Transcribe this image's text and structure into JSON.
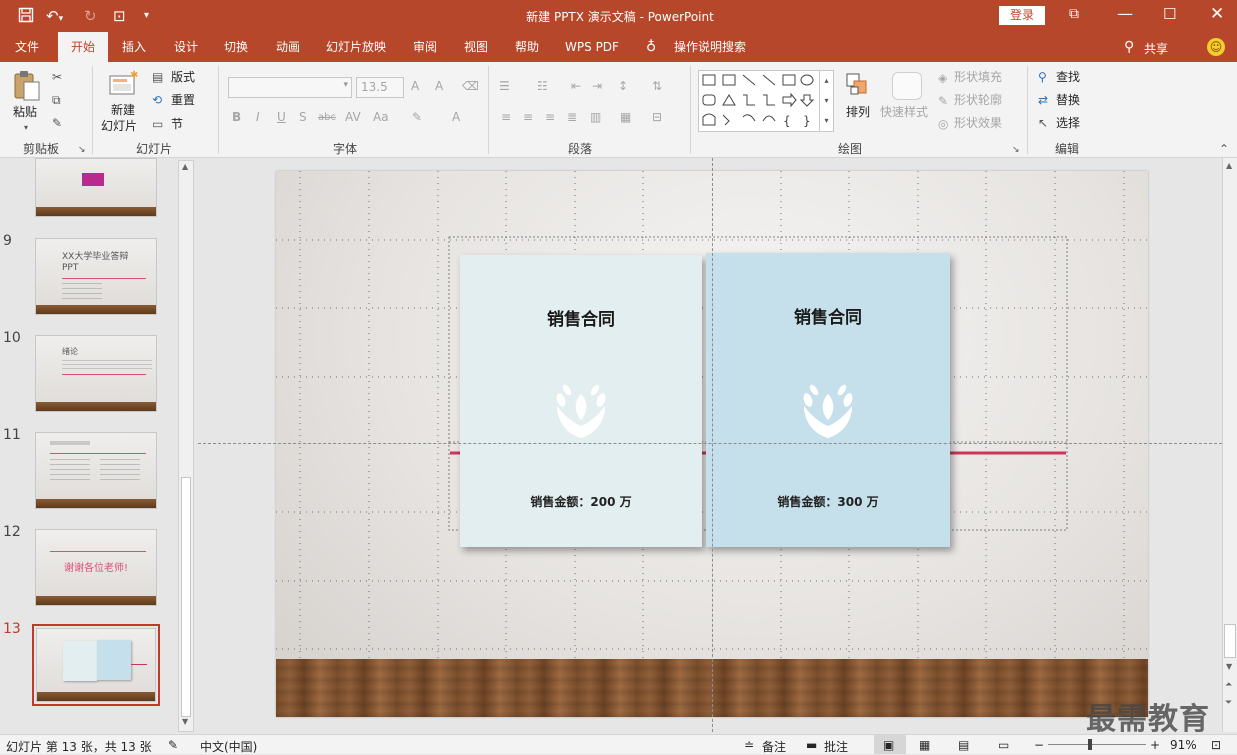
{
  "window": {
    "title": "新建 PPTX 演示文稿 - PowerPoint",
    "login_label": "登录"
  },
  "tabs": [
    {
      "label": "文件"
    },
    {
      "label": "开始"
    },
    {
      "label": "插入"
    },
    {
      "label": "设计"
    },
    {
      "label": "切换"
    },
    {
      "label": "动画"
    },
    {
      "label": "幻灯片放映"
    },
    {
      "label": "审阅"
    },
    {
      "label": "视图"
    },
    {
      "label": "帮助"
    },
    {
      "label": "WPS PDF"
    },
    {
      "label": "操作说明搜索"
    }
  ],
  "share_label": "共享",
  "ribbon": {
    "clipboard": {
      "paste": "粘贴",
      "group": "剪贴板"
    },
    "slides": {
      "new_slide_1": "新建",
      "new_slide_2": "幻灯片",
      "layout": "版式",
      "reset": "重置",
      "section": "节",
      "group": "幻灯片"
    },
    "font": {
      "size": "13.5",
      "group": "字体"
    },
    "paragraph": {
      "group": "段落"
    },
    "drawing": {
      "arrange": "排列",
      "quick_styles": "快速样式",
      "shape_fill": "形状填充",
      "shape_outline": "形状轮廓",
      "shape_effects": "形状效果",
      "group": "绘图"
    },
    "editing": {
      "find": "查找",
      "replace": "替换",
      "select": "选择",
      "group": "编辑"
    }
  },
  "thumbnails": {
    "numbers": [
      "9",
      "10",
      "11",
      "12",
      "13"
    ],
    "t9_title": "XX大学毕业答辩PPT",
    "t10_title": "绪论",
    "t12_text": "谢谢各位老师!"
  },
  "slide": {
    "card_left": {
      "title": "销售合同",
      "amount": "销售金额：200 万"
    },
    "card_right": {
      "title": "销售合同",
      "amount": "销售金额：300 万"
    }
  },
  "status": {
    "slide_info": "幻灯片 第 13 张，共 13 张",
    "language": "中文(中国)",
    "notes": "备注",
    "comments": "批注",
    "zoom": "91%"
  },
  "watermark": "最需教育",
  "colors": {
    "accent": "#b7472a",
    "card_left": "#e3eef0",
    "card_right": "#c5e0ea",
    "pink_line": "#c8375a"
  }
}
